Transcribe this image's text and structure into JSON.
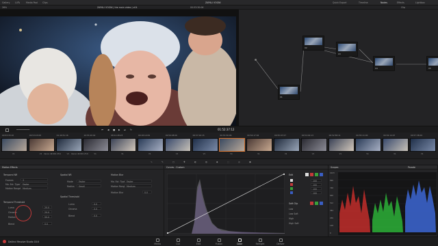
{
  "app_title": "DaVinci Resolve Studio 18.6",
  "topbar": {
    "left_items": [
      "Gallery",
      "LUTs",
      "Media Pool",
      "Clips"
    ],
    "center_title": "ZAPALI VOGNI",
    "right_items": [
      "Quick Export",
      "Timeline",
      "Nodes",
      "Effects",
      "Lightbox"
    ]
  },
  "subbar": {
    "zoom": "26%",
    "clip_title": "ZAPALI VOGNI | the main video | v04",
    "timecode": "00:53:30:06",
    "mode": "Clip"
  },
  "transport": {
    "timecode": "01:52:37:12"
  },
  "timeline": {
    "clips": [
      {
        "tc": "00:53:33:10",
        "track": "V1"
      },
      {
        "tc": "00:53:43:08",
        "track": "V1"
      },
      {
        "tc": "01:49:51:16",
        "track": "V1"
      },
      {
        "tc": "10:53:20:02",
        "track": "V1"
      },
      {
        "tc": "08:11:28:23",
        "track": "V1"
      },
      {
        "tc": "00:18:14:09",
        "track": "V1"
      },
      {
        "tc": "00:56:08:06",
        "track": "V1"
      },
      {
        "tc": "00:57:02:15",
        "track": "V1"
      },
      {
        "tc": "00:53:30:06",
        "track": "V1"
      },
      {
        "tc": "00:54:17:02",
        "track": "V1"
      },
      {
        "tc": "00:55:07:07",
        "track": "V1"
      },
      {
        "tc": "00:54:02:13",
        "track": "V1"
      },
      {
        "tc": "00:52:58:11",
        "track": "V1"
      },
      {
        "tc": "00:55:11:00",
        "track": "V1"
      },
      {
        "tc": "00:52:14:07",
        "track": "V1"
      },
      {
        "tc": "00:57:38:09",
        "track": "V1"
      }
    ],
    "clip_label": "Canon 4K 601 23.6"
  },
  "nodes": [
    {
      "label": "01"
    },
    {
      "label": "02"
    },
    {
      "label": "03"
    },
    {
      "label": "04"
    },
    {
      "label": "05"
    }
  ],
  "motion_effects": {
    "title": "Motion Effects",
    "temporal_nr": "Temporal NR",
    "frames_label": "Frames",
    "frames_value": "3",
    "mo_est_type_label": "Mo. Est. Type",
    "mo_est_type_value": "Faster",
    "motion_range_label": "Motion Range",
    "motion_range_value": "Medium",
    "temporal_threshold": "Temporal Threshold",
    "luma_label": "Luma",
    "luma_value": "20.0",
    "chroma_label": "Chroma",
    "chroma_value": "20.0",
    "motion_label": "Motion",
    "motion_value": "50.0",
    "blend_label": "Blend",
    "blend_value": "0.0",
    "spatial_nr": "Spatial NR",
    "mode_label": "Mode",
    "mode_value": "Faster",
    "radius_label": "Radius",
    "radius_value": "Small",
    "spatial_threshold": "Spatial Threshold",
    "s_luma_value": "0.0",
    "s_chroma_value": "0.0",
    "s_blend_value": "0.0",
    "motion_blur": "Motion Blur",
    "mb_type_label": "Mo. Est. Type",
    "mb_type_value": "Faster",
    "mb_range_label": "Motion Range",
    "mb_range_value": "Medium",
    "mb_blur_label": "Motion Blur",
    "mb_blur_value": "0.0"
  },
  "curves": {
    "title": "Curves - Custom",
    "edit_label": "Edit",
    "values": [
      "100",
      "100",
      "100",
      "100"
    ],
    "soft_clip": "Soft Clip",
    "low_label": "Low",
    "low_soft_label": "Low Soft",
    "high_label": "High",
    "high_soft_label": "High Soft"
  },
  "scopes": {
    "title": "Scopes",
    "mode": "Parade",
    "ticks": [
      "1023",
      "896",
      "768",
      "640",
      "512",
      "384",
      "256",
      "128",
      "0"
    ]
  },
  "pages": [
    "Media",
    "Cut",
    "Edit",
    "Fusion",
    "Color",
    "Fairlight",
    "Deliver"
  ],
  "active_page": "Color",
  "colors": {
    "accent": "#d26f2b",
    "bg": "#1c1c1e"
  }
}
